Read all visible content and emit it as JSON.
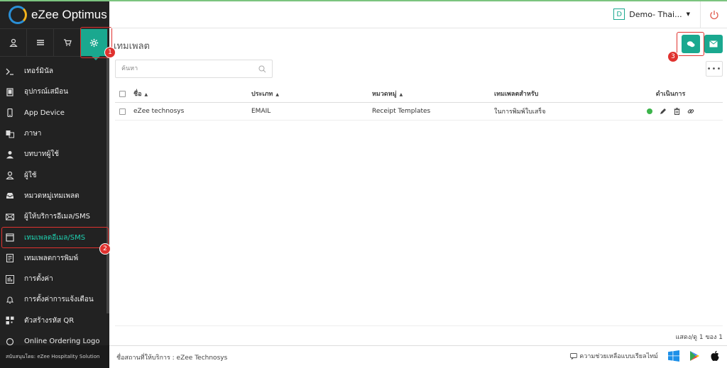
{
  "app": {
    "name": "eZee Optimus"
  },
  "sidebar": {
    "items": [
      {
        "label": "เทอร์มินัล",
        "icon": "terminal-icon"
      },
      {
        "label": "อุปกรณ์เสมือน",
        "icon": "tablet-icon"
      },
      {
        "label": "App Device",
        "icon": "mobile-icon"
      },
      {
        "label": "ภาษา",
        "icon": "language-icon"
      },
      {
        "label": "บทบาทผู้ใช้",
        "icon": "user-role-icon"
      },
      {
        "label": "ผู้ใช้",
        "icon": "user-icon"
      },
      {
        "label": "หมวดหมู่เทมเพลต",
        "icon": "inbox-icon"
      },
      {
        "label": "ผู้ให้บริการอีเมล/SMS",
        "icon": "envelope-icon"
      },
      {
        "label": "เทมเพลตอีเมล/SMS",
        "icon": "window-icon"
      },
      {
        "label": "เทมเพลตการพิมพ์",
        "icon": "print-template-icon"
      },
      {
        "label": "การตั้งค่า",
        "icon": "settings-panel-icon"
      },
      {
        "label": "การตั้งค่าการแจ้งเตือน",
        "icon": "bell-icon"
      },
      {
        "label": "ตัวสร้างรหัส QR",
        "icon": "qr-icon"
      },
      {
        "label": "Online Ordering Logo",
        "icon": "logo-icon"
      }
    ],
    "active_index": 8,
    "footer": "สนับสนุนโดย: eZee Hospitality Solution"
  },
  "callouts": [
    "1",
    "2",
    "3"
  ],
  "header": {
    "property_letter": "D",
    "property_name": "Demo- Thai..."
  },
  "page": {
    "title": "เทมเพลต",
    "search_placeholder": "ค้นหา",
    "more_label": "•••"
  },
  "table": {
    "columns": [
      "ชื่อ",
      "ประเภท",
      "หมวดหมู่",
      "เทมเพลตสำหรับ",
      "ดำเนินการ"
    ],
    "rows": [
      {
        "name": "eZee technosys",
        "type": "EMAIL",
        "category": "Receipt Templates",
        "template_for": "ในการพิมพ์ใบเสร็จ"
      }
    ]
  },
  "pager": "แสดง/ดู 1 ของ 1",
  "footer": {
    "business": "ชื่อสถานที่ให้บริการ : eZee Technosys",
    "help": "ความช่วยเหลือแบบเรียลไทม์"
  },
  "colors": {
    "accent": "#1aa88f",
    "callout": "#e0322f",
    "sidebar": "#222222",
    "status_active": "#3cb44b"
  }
}
